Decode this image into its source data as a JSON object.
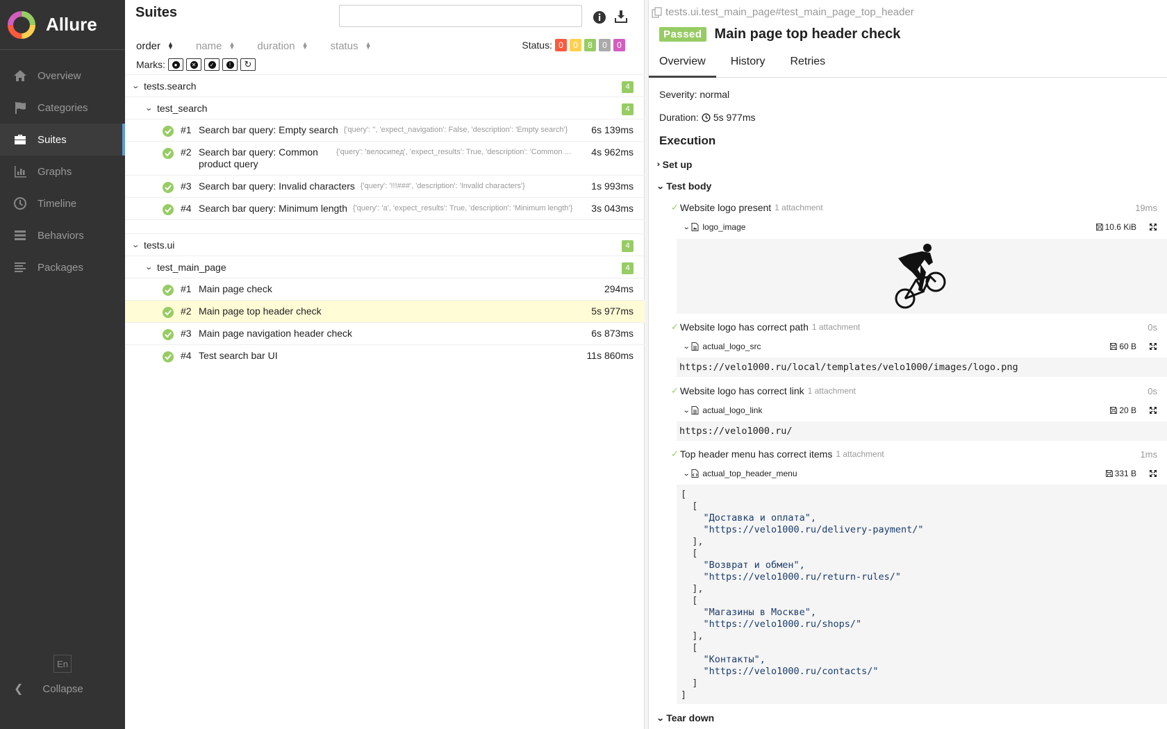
{
  "brand": {
    "name": "Allure"
  },
  "nav": [
    {
      "label": "Overview",
      "icon": "home-icon"
    },
    {
      "label": "Categories",
      "icon": "flag-icon"
    },
    {
      "label": "Suites",
      "icon": "briefcase-icon"
    },
    {
      "label": "Graphs",
      "icon": "bar-chart-icon"
    },
    {
      "label": "Timeline",
      "icon": "clock-icon"
    },
    {
      "label": "Behaviors",
      "icon": "list-icon"
    },
    {
      "label": "Packages",
      "icon": "align-left-icon"
    }
  ],
  "sidebar_footer": {
    "lang": "En",
    "collapse": "Collapse"
  },
  "suites": {
    "title": "Suites",
    "search_placeholder": "",
    "sort": [
      "order",
      "name",
      "duration",
      "status"
    ],
    "status_label": "Status:",
    "status_counts": [
      {
        "value": "0",
        "color": "#fd5a3e"
      },
      {
        "value": "0",
        "color": "#ffd050"
      },
      {
        "value": "8",
        "color": "#97cc64"
      },
      {
        "value": "0",
        "color": "#aaaaaa"
      },
      {
        "value": "0",
        "color": "#d35ebe"
      }
    ],
    "marks_label": "Marks:",
    "groups": [
      {
        "name": "tests.search",
        "count": "4",
        "sub": {
          "name": "test_search",
          "count": "4",
          "tests": [
            {
              "num": "#1",
              "name": "Search bar query: Empty search",
              "params": "{'query': '', 'expect_navigation': False, 'description': 'Empty search'}",
              "duration": "6s 139ms"
            },
            {
              "num": "#2",
              "name": "Search bar query: Common product query",
              "params": "{'query': 'велосипед', 'expect_results': True, 'description': 'Common ...",
              "duration": "4s 962ms"
            },
            {
              "num": "#3",
              "name": "Search bar query: Invalid characters",
              "params": "{'query': '!!!###', 'description': 'Invalid characters'}",
              "duration": "1s 993ms"
            },
            {
              "num": "#4",
              "name": "Search bar query: Minimum length",
              "params": "{'query': 'a', 'expect_results': True, 'description': 'Minimum length'}",
              "duration": "3s 043ms"
            }
          ]
        }
      },
      {
        "name": "tests.ui",
        "count": "4",
        "sub": {
          "name": "test_main_page",
          "count": "4",
          "tests": [
            {
              "num": "#1",
              "name": "Main page check",
              "params": "",
              "duration": "294ms"
            },
            {
              "num": "#2",
              "name": "Main page top header check",
              "params": "",
              "duration": "5s 977ms"
            },
            {
              "num": "#3",
              "name": "Main page navigation header check",
              "params": "",
              "duration": "6s 873ms"
            },
            {
              "num": "#4",
              "name": "Test search bar UI",
              "params": "",
              "duration": "11s 860ms"
            }
          ]
        }
      }
    ]
  },
  "detail": {
    "breadcrumb": "tests.ui.test_main_page#test_main_page_top_header",
    "status": "Passed",
    "title": "Main page top header check",
    "tabs": [
      "Overview",
      "History",
      "Retries"
    ],
    "severity": "Severity: normal",
    "duration_label": "Duration:",
    "duration_value": "5s 977ms",
    "execution_title": "Execution",
    "setup_label": "Set up",
    "body_label": "Test body",
    "teardown_label": "Tear down",
    "steps": [
      {
        "name": "Website logo present",
        "attachments": "1 attachment",
        "time": "19ms",
        "att_name": "logo_image",
        "att_size": "10.6 KiB"
      },
      {
        "name": "Website logo has correct path",
        "attachments": "1 attachment",
        "time": "0s",
        "att_name": "actual_logo_src",
        "att_size": "60 B",
        "content": "https://velo1000.ru/local/templates/velo1000/images/logo.png"
      },
      {
        "name": "Website logo has correct link",
        "attachments": "1 attachment",
        "time": "0s",
        "att_name": "actual_logo_link",
        "att_size": "20 B",
        "content": "https://velo1000.ru/"
      },
      {
        "name": "Top header menu has correct items",
        "attachments": "1 attachment",
        "time": "1ms",
        "att_name": "actual_top_header_menu",
        "att_size": "331 B"
      }
    ],
    "json_lines": [
      "[",
      "  [",
      "    \"Доставка и оплата\",",
      "    \"https://velo1000.ru/delivery-payment/\"",
      "  ],",
      "  [",
      "    \"Возврат и обмен\",",
      "    \"https://velo1000.ru/return-rules/\"",
      "  ],",
      "  [",
      "    \"Магазины в Москве\",",
      "    \"https://velo1000.ru/shops/\"",
      "  ],",
      "  [",
      "    \"Контакты\",",
      "    \"https://velo1000.ru/contacts/\"",
      "  ]",
      "]"
    ]
  }
}
